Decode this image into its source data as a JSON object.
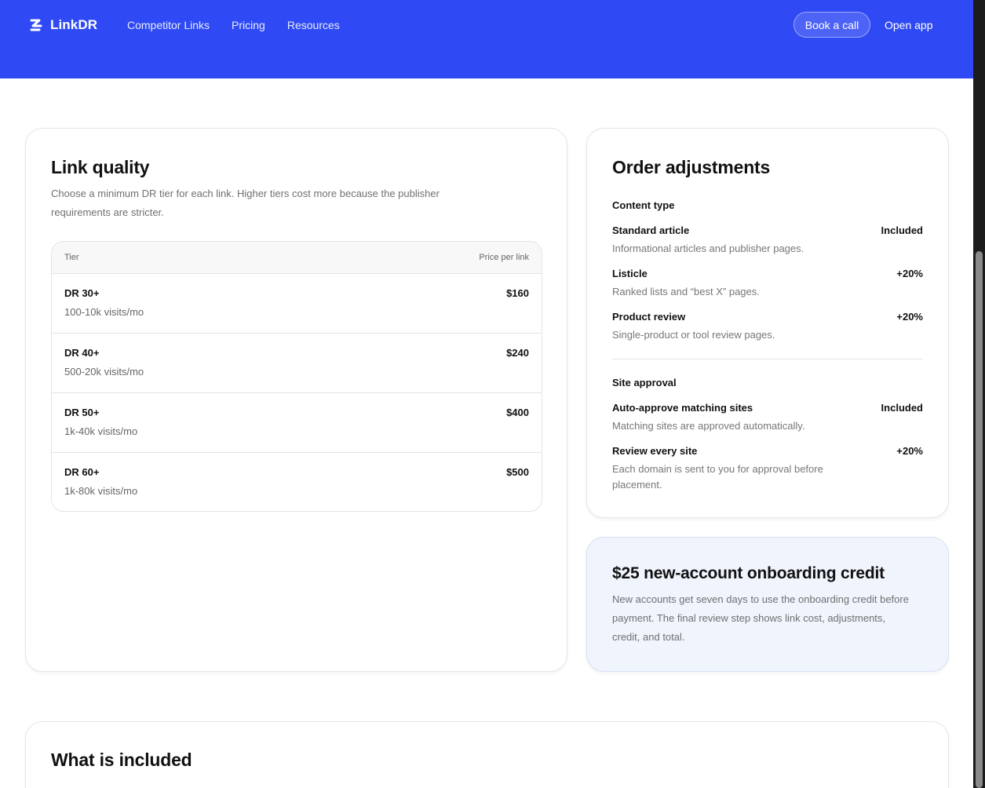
{
  "header": {
    "brand": "LinkDR",
    "nav": [
      "Competitor Links",
      "Pricing",
      "Resources"
    ],
    "book_call": "Book a call",
    "open_app": "Open app",
    "bg_color": "#2f4af5"
  },
  "link_quality": {
    "title": "Link quality",
    "description": "Choose a minimum DR tier for each link. Higher tiers cost more because the publisher requirements are stricter.",
    "table": {
      "col_tier": "Tier",
      "col_price": "Price per link",
      "rows": [
        {
          "tier": "DR 30+",
          "traffic": "100-10k visits/mo",
          "price": "$160"
        },
        {
          "tier": "DR 40+",
          "traffic": "500-20k visits/mo",
          "price": "$240"
        },
        {
          "tier": "DR 50+",
          "traffic": "1k-40k visits/mo",
          "price": "$400"
        },
        {
          "tier": "DR 60+",
          "traffic": "1k-80k visits/mo",
          "price": "$500"
        }
      ]
    }
  },
  "order_adjustments": {
    "title": "Order adjustments",
    "content_type": {
      "label": "Content type",
      "items": [
        {
          "name": "Standard article",
          "value": "Included",
          "desc": "Informational articles and publisher pages."
        },
        {
          "name": "Listicle",
          "value": "+20%",
          "desc": "Ranked lists and “best X” pages."
        },
        {
          "name": "Product review",
          "value": "+20%",
          "desc": "Single-product or tool review pages."
        }
      ]
    },
    "site_approval": {
      "label": "Site approval",
      "items": [
        {
          "name": "Auto-approve matching sites",
          "value": "Included",
          "desc": "Matching sites are approved automatically."
        },
        {
          "name": "Review every site",
          "value": "+20%",
          "desc": "Each domain is sent to you for approval before placement."
        }
      ]
    }
  },
  "credit": {
    "title": "$25 new-account onboarding credit",
    "description": "New accounts get seven days to use the onboarding credit before payment. The final review step shows link cost, adjustments, credit, and total."
  },
  "included": {
    "title": "What is included"
  }
}
